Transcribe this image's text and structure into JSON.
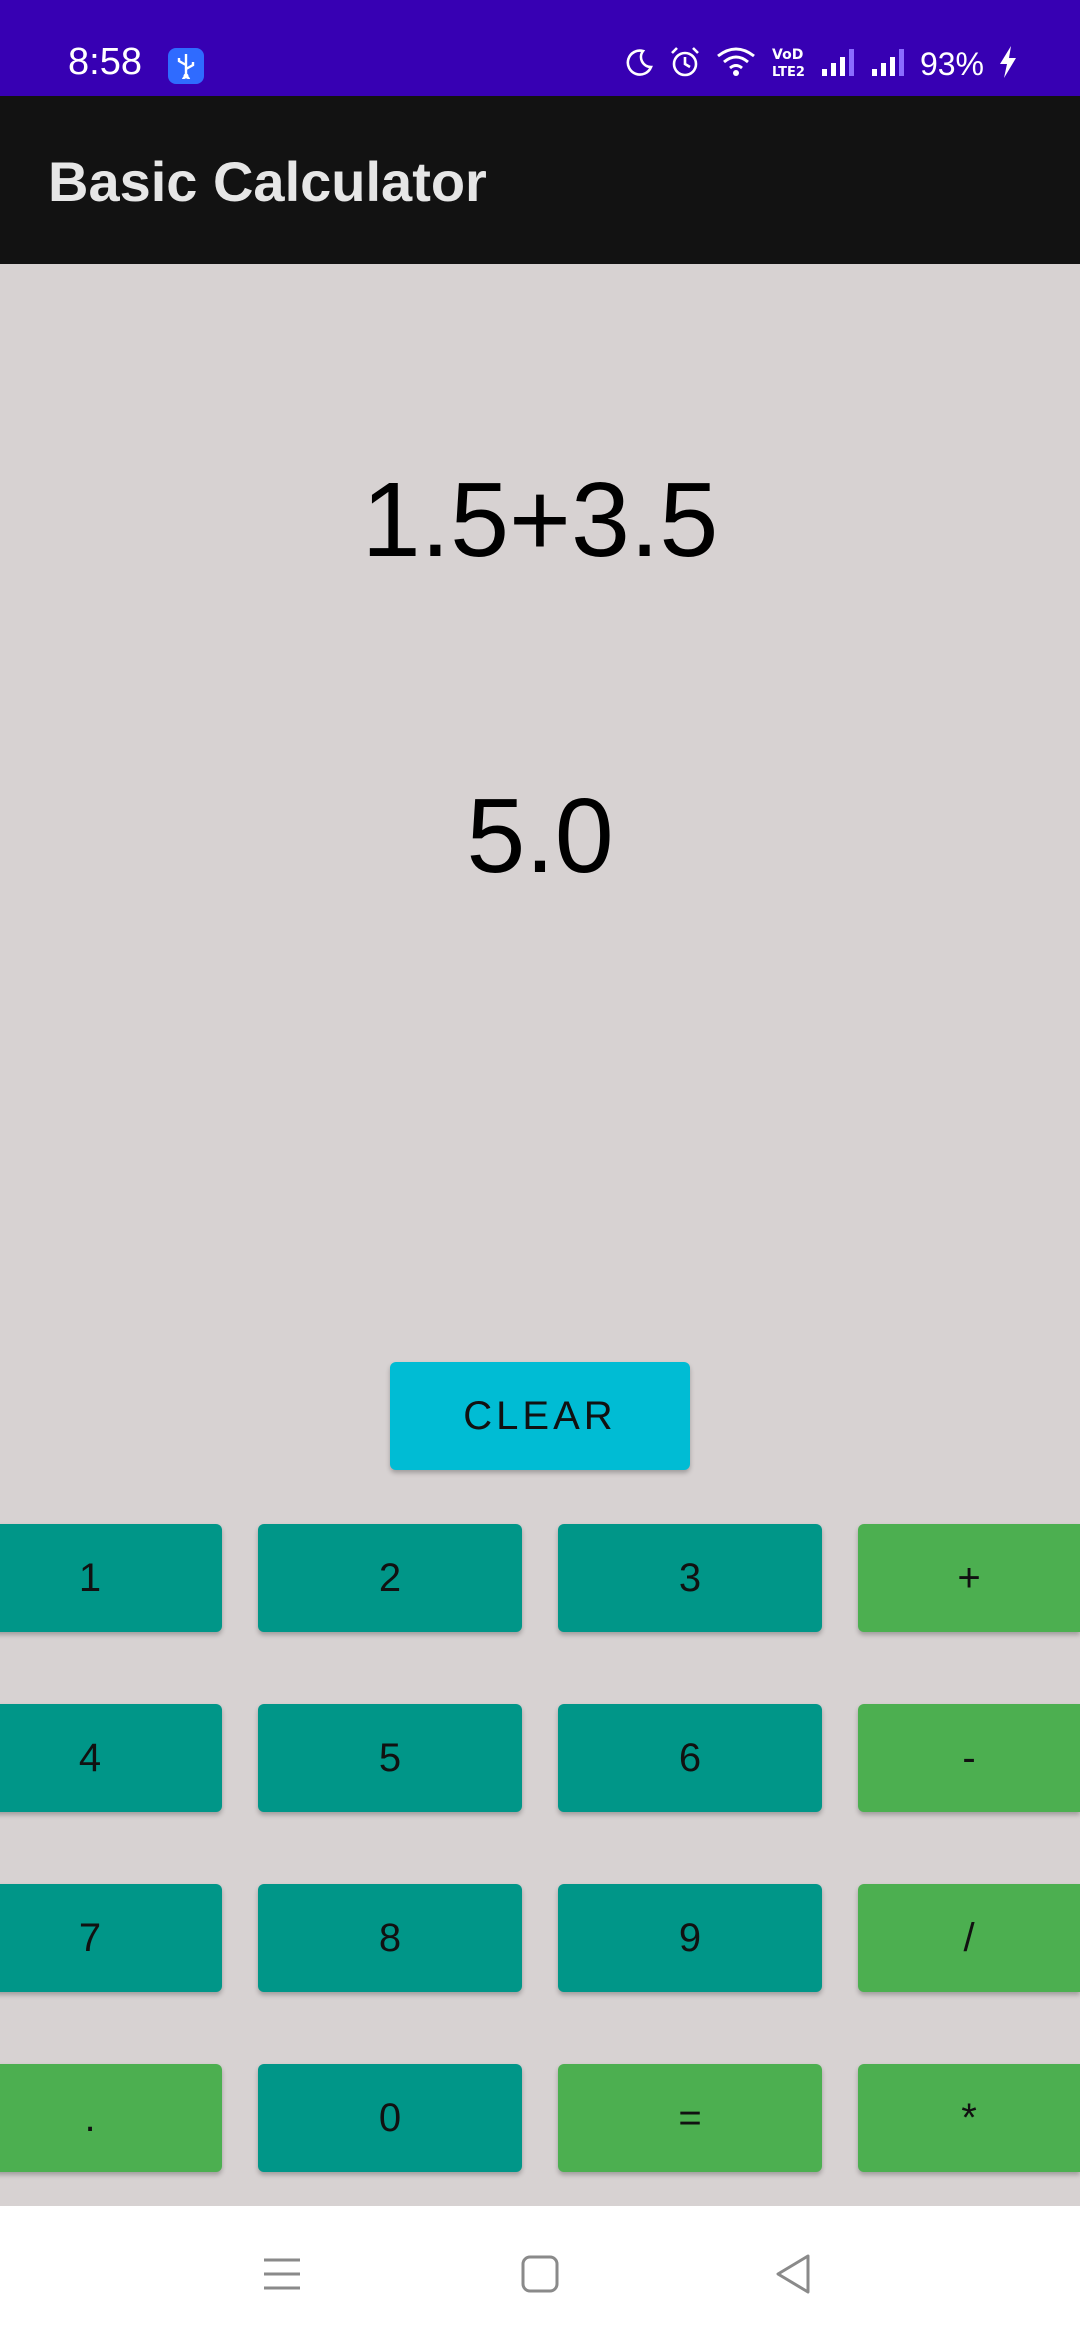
{
  "status_bar": {
    "time": "8:58",
    "battery": "93%",
    "icons": [
      "usb-icon",
      "moon-icon",
      "alarm-icon",
      "wifi-icon",
      "volte-icon",
      "signal-icon",
      "signal-icon",
      "bolt-icon"
    ]
  },
  "app_bar": {
    "title": "Basic Calculator"
  },
  "display": {
    "expression": "1.5+3.5",
    "result": "5.0"
  },
  "buttons": {
    "clear": "CLEAR",
    "row1": [
      "1",
      "2",
      "3",
      "+"
    ],
    "row2": [
      "4",
      "5",
      "6",
      "-"
    ],
    "row3": [
      "7",
      "8",
      "9",
      "/"
    ],
    "row4": [
      ".",
      "0",
      "=",
      "*"
    ]
  },
  "colors": {
    "status_bar": "#3700b3",
    "app_bar": "#121212",
    "background": "#d7d2d2",
    "clear_button": "#00bcd4",
    "digit_button": "#009688",
    "operator_button": "#4caf50"
  },
  "nav_bar": {
    "icons": [
      "menu-icon",
      "home-icon",
      "back-icon"
    ]
  }
}
